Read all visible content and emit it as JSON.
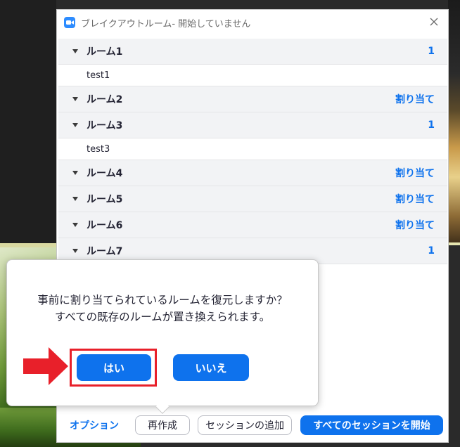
{
  "window": {
    "title": "ブレイクアウトルーム- 開始していません",
    "icons": {
      "app": "zoom-camera-icon",
      "close": "close-icon"
    }
  },
  "rooms": [
    {
      "name": "ルーム1",
      "right": "1",
      "members": [
        "test1"
      ]
    },
    {
      "name": "ルーム2",
      "right": "割り当て",
      "members": []
    },
    {
      "name": "ルーム3",
      "right": "1",
      "members": [
        "test3"
      ]
    },
    {
      "name": "ルーム4",
      "right": "割り当て",
      "members": []
    },
    {
      "name": "ルーム5",
      "right": "割り当て",
      "members": []
    },
    {
      "name": "ルーム6",
      "right": "割り当て",
      "members": []
    },
    {
      "name": "ルーム7",
      "right": "1",
      "members": []
    }
  ],
  "toolbar": {
    "options": "オプション",
    "recreate": "再作成",
    "add_session": "セッションの追加",
    "start_all": "すべてのセッションを開始"
  },
  "popup": {
    "line1": "事前に割り当てられているルームを復元しますか？",
    "line2": "すべての既存のルームが置き換えられます。",
    "yes": "はい",
    "no": "いいえ"
  },
  "colors": {
    "accent": "#0e72ed",
    "annotation": "#e8202a"
  }
}
